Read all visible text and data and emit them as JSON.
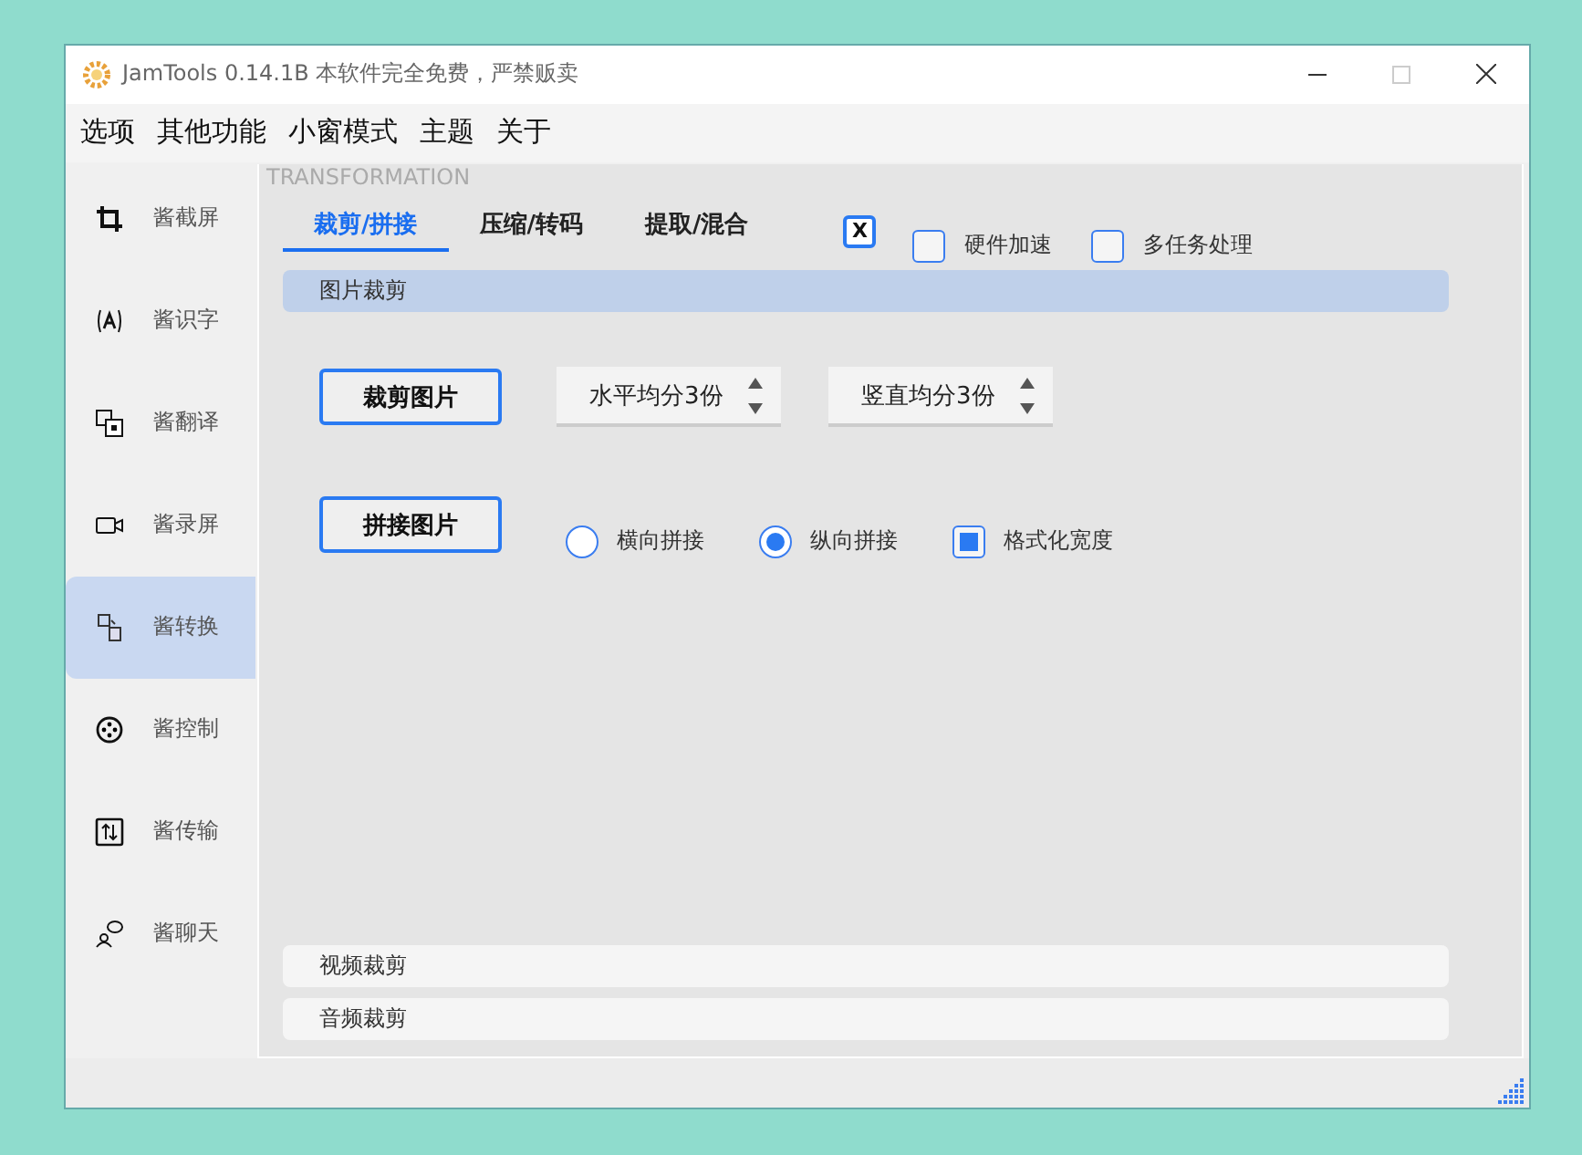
{
  "window": {
    "title": "JamTools 0.14.1B 本软件完全免费，严禁贩卖"
  },
  "menu": [
    "选项",
    "其他功能",
    "小窗模式",
    "主题",
    "关于"
  ],
  "sidebar": {
    "items": [
      {
        "label": "酱截屏",
        "selected": false
      },
      {
        "label": "酱识字",
        "selected": false
      },
      {
        "label": "酱翻译",
        "selected": false
      },
      {
        "label": "酱录屏",
        "selected": false
      },
      {
        "label": "酱转换",
        "selected": true
      },
      {
        "label": "酱控制",
        "selected": false
      },
      {
        "label": "酱传输",
        "selected": false
      },
      {
        "label": "酱聊天",
        "selected": false
      }
    ]
  },
  "panel": {
    "title": "TRANSFORMATION",
    "tabs": [
      {
        "label": "裁剪/拼接",
        "selected": true
      },
      {
        "label": "压缩/转码",
        "selected": false
      },
      {
        "label": "提取/混合",
        "selected": false
      }
    ],
    "close_button": {
      "label": "X"
    },
    "options": [
      {
        "label": "硬件加速",
        "checked": false
      },
      {
        "label": "多任务处理",
        "checked": false
      }
    ],
    "sections": [
      {
        "title": "图片裁剪",
        "expanded": true
      },
      {
        "title": "视频裁剪",
        "expanded": false
      },
      {
        "title": "音频裁剪",
        "expanded": false
      }
    ],
    "crop_button": {
      "label": "裁剪图片"
    },
    "spinners": [
      {
        "value": "水平均分3份"
      },
      {
        "value": "竖直均分3份"
      }
    ],
    "join_button": {
      "label": "拼接图片"
    },
    "radios": [
      {
        "label": "横向拼接",
        "selected": false
      },
      {
        "label": "纵向拼接",
        "selected": true
      }
    ],
    "format_width": {
      "label": "格式化宽度",
      "checked": true
    }
  }
}
